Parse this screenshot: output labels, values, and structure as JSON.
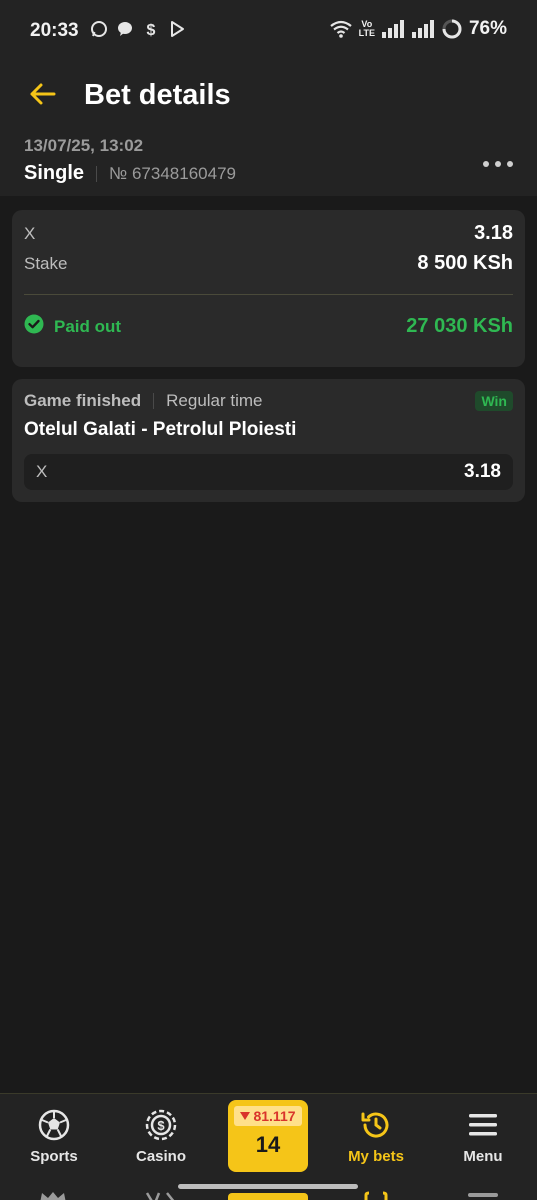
{
  "status_bar": {
    "time": "20:33",
    "battery": "76%",
    "network_top": "Vo",
    "network_bottom": "LTE"
  },
  "header": {
    "title": "Bet details"
  },
  "bet": {
    "date": "13/07/25, 13:02",
    "type": "Single",
    "number": "№ 67348160479"
  },
  "summary": {
    "outcome_label": "X",
    "outcome_odds": "3.18",
    "stake_label": "Stake",
    "stake_value": "8 500 KSh",
    "paid_label": "Paid out",
    "paid_value": "27 030 KSh"
  },
  "event": {
    "status": "Game finished",
    "period": "Regular time",
    "result_badge": "Win",
    "match": "Otelul Galati - Petrolul Ploiesti",
    "selection_label": "X",
    "selection_odds": "3.18"
  },
  "bottom_nav": {
    "items": [
      {
        "label": "Sports",
        "icon": "soccer-ball-icon"
      },
      {
        "label": "Casino",
        "icon": "casino-chip-icon"
      },
      {
        "label": "My bets",
        "icon": "history-icon",
        "active": true
      },
      {
        "label": "Menu",
        "icon": "menu-icon"
      }
    ],
    "coupon_odds": "81.117",
    "coupon_count": "14"
  },
  "colors": {
    "accent": "#f5c518",
    "success": "#2fb852",
    "background": "#1a1a1a",
    "card": "#2a2a2a"
  }
}
